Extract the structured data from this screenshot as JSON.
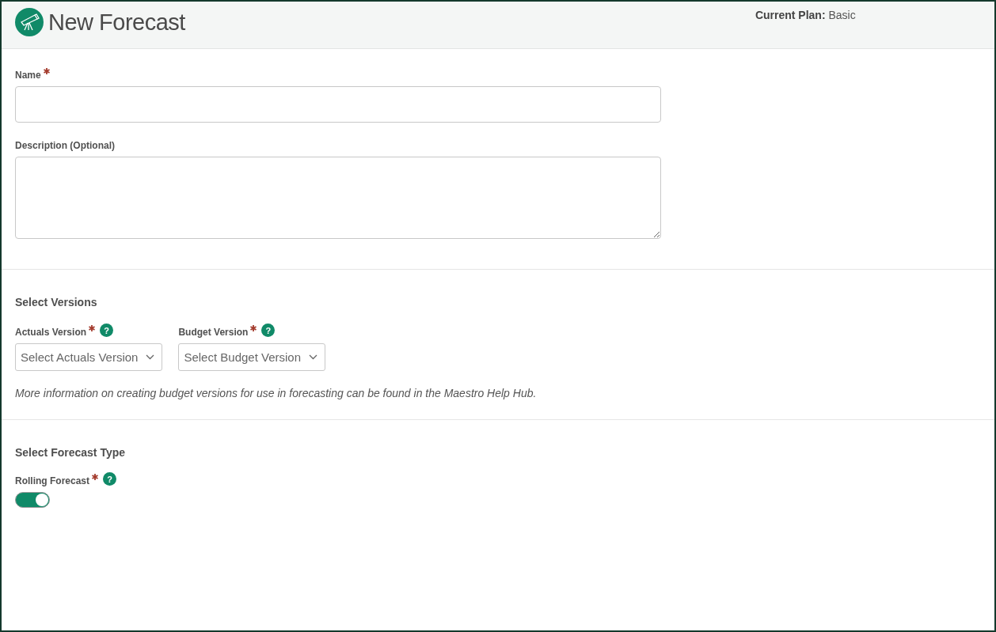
{
  "header": {
    "title": "New Forecast",
    "plan": "**Current Plan:** Basic"
  },
  "fields": [
    {
      "label": "Name",
      "required": true,
      "kind": "input"
    },
    {
      "label": "Description (Optional)",
      "required": false,
      "kind": "textarea"
    }
  ],
  "sections": [
    {
      "title": "Select Versions",
      "selects": [
        {
          "label": "Actuals Version",
          "required": true,
          "help": "?",
          "placeholder": "Select Actuals Version"
        },
        {
          "label": "Budget Version",
          "required": true,
          "help": "?",
          "placeholder": "Select Budget Version"
        }
      ],
      "note": "More information on creating budget versions for use in forecasting can be found in the Maestro Help Hub."
    },
    {
      "title": "Select Forecast Type",
      "toggle": {
        "label": "Rolling Forecast",
        "required": true,
        "help": "?",
        "on": true
      }
    }
  ]
}
